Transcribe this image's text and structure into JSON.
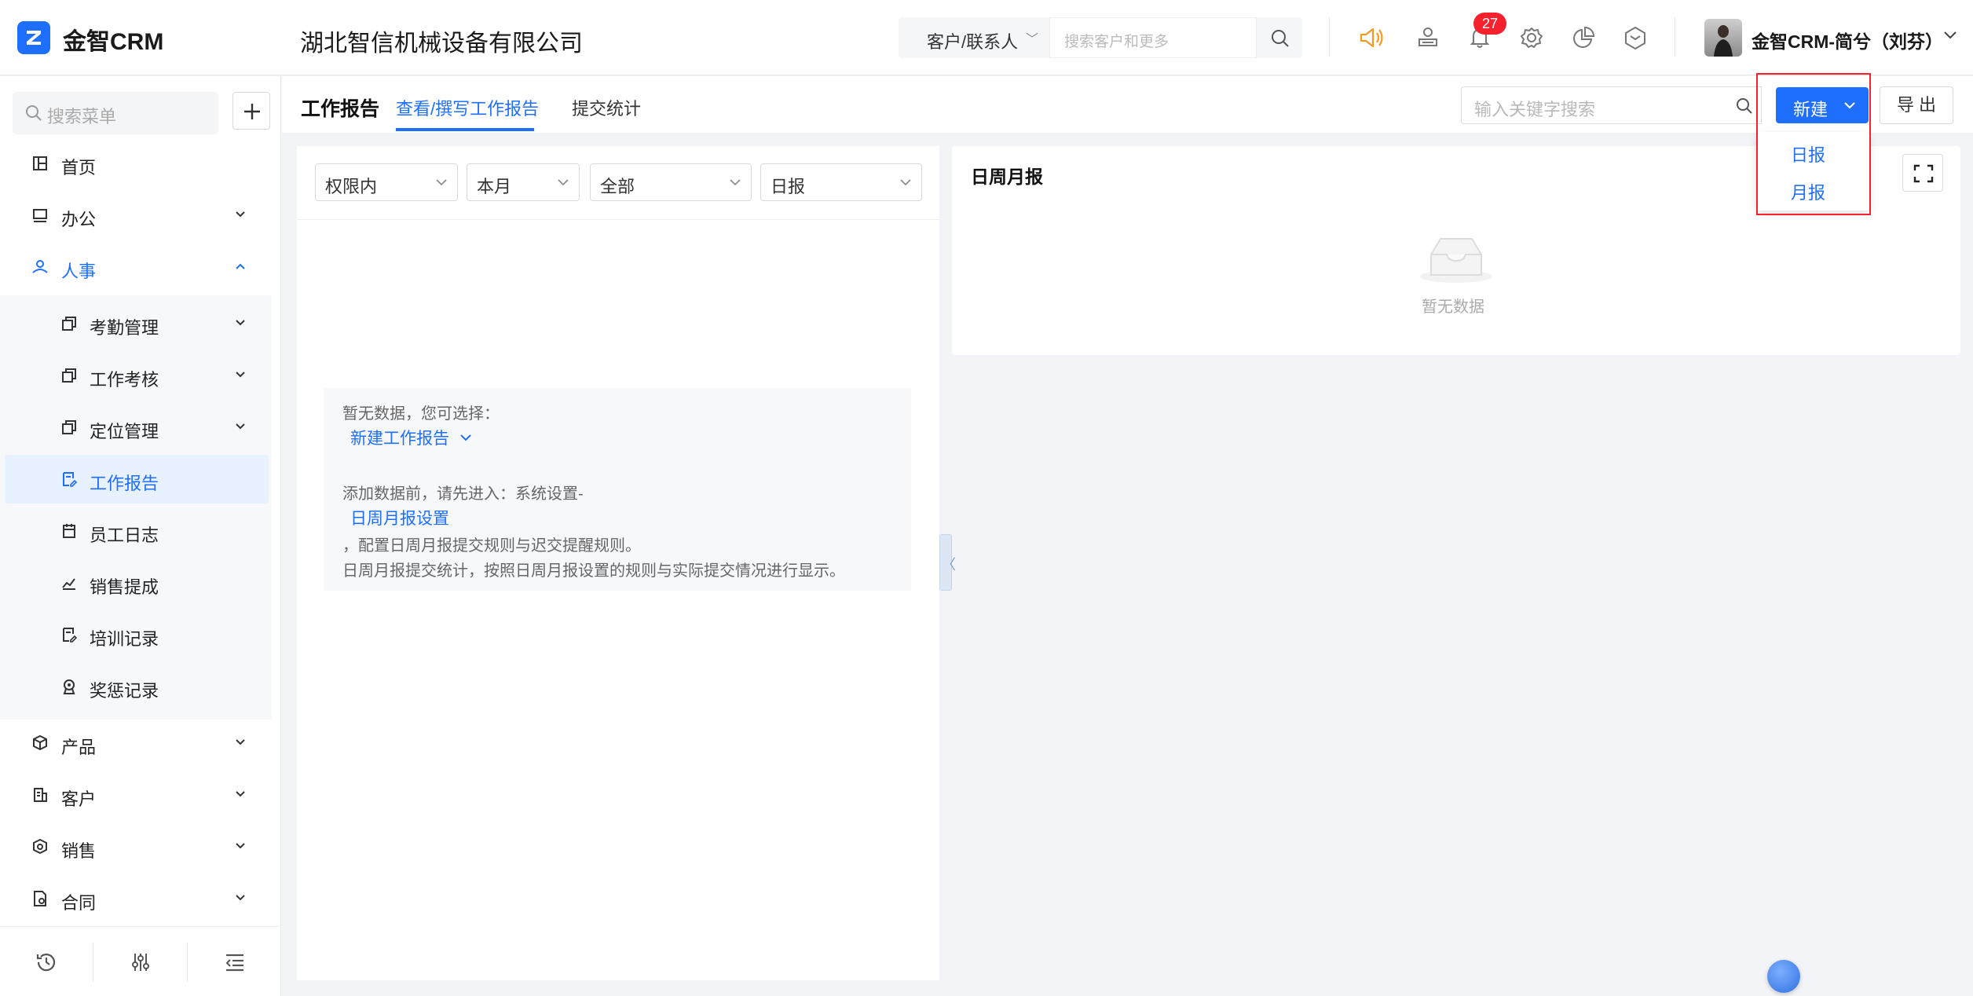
{
  "app": {
    "logo_text": "金智CRM",
    "company": "湖北智信机械设备有限公司"
  },
  "topbar": {
    "search_type": "客户/联系人",
    "search_placeholder": "搜索客户和更多",
    "notification_count": "27",
    "user_name": "金智CRM-简兮（刘芬）"
  },
  "sidebar": {
    "search_placeholder": "搜索菜单",
    "items": [
      {
        "label": "首页"
      },
      {
        "label": "办公"
      },
      {
        "label": "人事"
      },
      {
        "label": "产品"
      },
      {
        "label": "客户"
      },
      {
        "label": "销售"
      },
      {
        "label": "合同"
      }
    ],
    "sub_items": [
      {
        "label": "考勤管理"
      },
      {
        "label": "工作考核"
      },
      {
        "label": "定位管理"
      },
      {
        "label": "工作报告"
      },
      {
        "label": "员工日志"
      },
      {
        "label": "销售提成"
      },
      {
        "label": "培训记录"
      },
      {
        "label": "奖惩记录"
      }
    ]
  },
  "header": {
    "title": "工作报告",
    "tabs": [
      {
        "label": "查看/撰写工作报告"
      },
      {
        "label": "提交统计"
      }
    ],
    "keyword_placeholder": "输入关键字搜索",
    "new_label": "新建",
    "export_label": "导 出",
    "new_menu": [
      {
        "label": "日报"
      },
      {
        "label": "月报"
      }
    ]
  },
  "filters": {
    "scope": "权限内",
    "period": "本月",
    "status": "全部",
    "type": "日报"
  },
  "empty_tip": {
    "line1": "暂无数据，您可选择：",
    "link1": "新建工作报告",
    "line2": "添加数据前，请先进入：系统设置-",
    "link2": "日周月报设置",
    "line3": "，配置日周月报提交规则与迟交提醒规则。",
    "line4": "日周月报提交统计，按照日周月报设置的规则与实际提交情况进行显示。"
  },
  "right_panel": {
    "title": "日周月报",
    "empty_text": "暂无数据"
  },
  "colors": {
    "accent": "#1f6fff",
    "badge": "#f5222d",
    "highlight": "#f5222d"
  }
}
